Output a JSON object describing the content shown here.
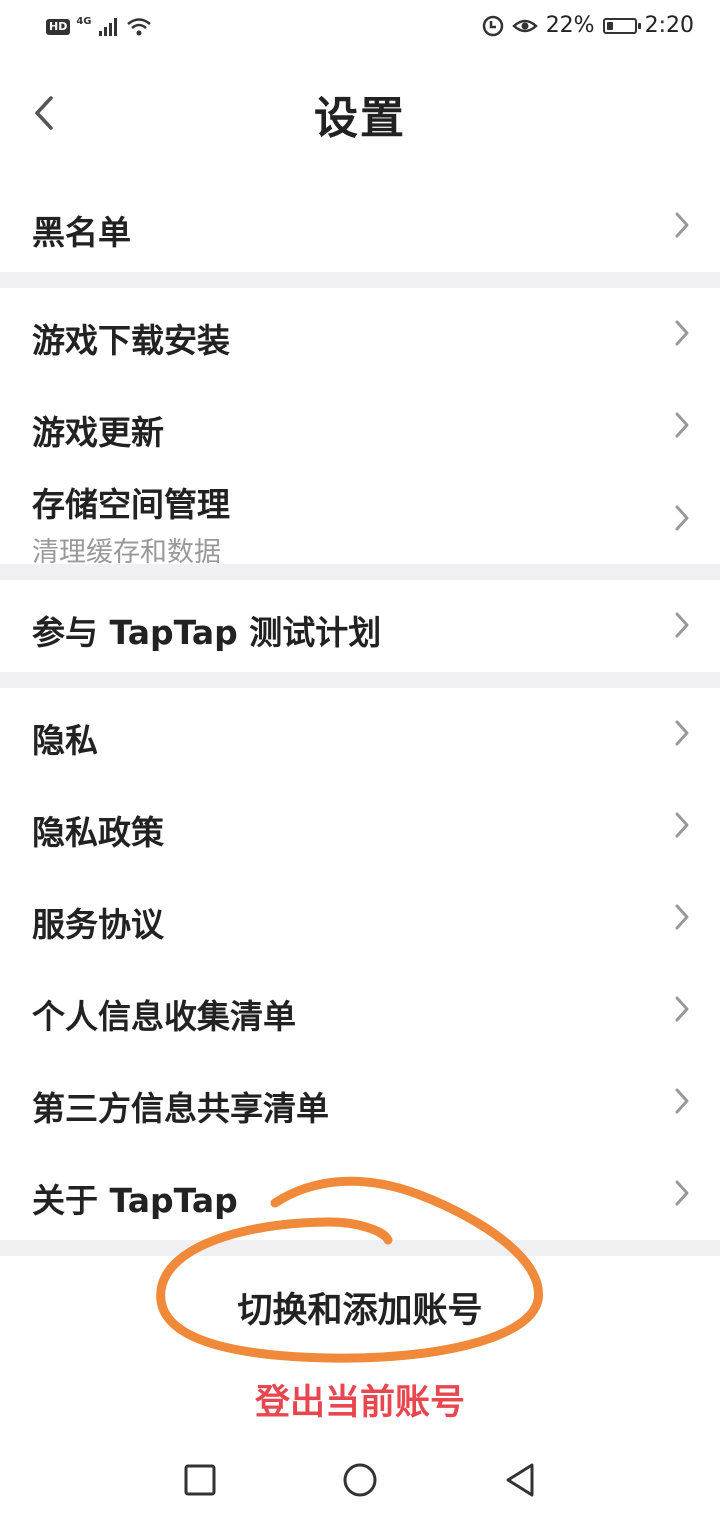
{
  "status_bar": {
    "hd": "HD",
    "network": "4G",
    "battery_percent": "22%",
    "battery_level": 0.22,
    "time": "2:20",
    "icons": [
      "signal-icon",
      "wifi-icon",
      "data-saver-icon",
      "eye-comfort-icon",
      "battery-icon"
    ]
  },
  "header": {
    "title": "设置",
    "back_icon": "chevron-left-icon"
  },
  "sections": {
    "blacklist": "黑名单",
    "game_download": "游戏下载安装",
    "game_update": "游戏更新",
    "storage": "存储空间管理",
    "storage_sub": "清理缓存和数据",
    "beta": "参与 TapTap 测试计划",
    "privacy": "隐私",
    "privacy_policy": "隐私政策",
    "service_agreement": "服务协议",
    "personal_info": "个人信息收集清单",
    "third_party": "第三方信息共享清单",
    "about": "关于 TapTap"
  },
  "actions": {
    "switch_account": "切换和添加账号",
    "logout": "登出当前账号"
  },
  "colors": {
    "logout_red": "#e8474f",
    "annotation_orange": "#f08a3a",
    "separator": "#f0f0f2"
  },
  "nav_bar": {
    "icons": [
      "recent-apps-icon",
      "home-icon",
      "back-icon"
    ]
  }
}
